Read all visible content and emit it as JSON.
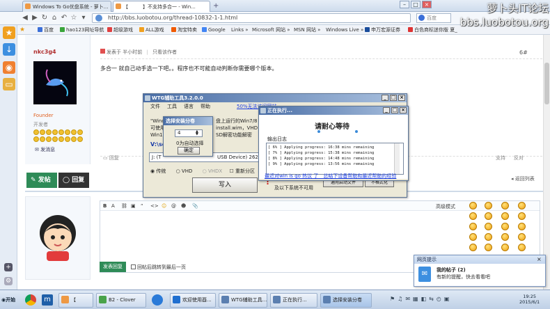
{
  "browser": {
    "tabs": [
      {
        "label": "Windows To Go优盘系统 - 萝卜...",
        "active": false
      },
      {
        "label": "【　　　】不支持多合一 - Win...",
        "active": true
      }
    ],
    "url": "http://bbs.luobotou.org/thread-10832-1-1.html",
    "search_placeholder": "百度",
    "bookmarks": [
      "百度",
      "hao123网址导航",
      "超级游戏",
      "ALL游戏",
      "淘宝特卖",
      "Google",
      "Links »",
      "Microsoft 网站 »",
      "MSN 网站 »",
      "Windows Live »",
      "申万宏源证券",
      "白色商标迷你版 夏_"
    ],
    "watermark": [
      "萝卜头IT论坛",
      "bbs.luobotou.org"
    ]
  },
  "post": {
    "username": "nkc3g4",
    "meta": "发表于 半小时前",
    "author_only": "只看该作者",
    "floor": "6#",
    "content": "多合一 就自己动手选一下吧。。程序也不可能自动判断你需要哪个版本。",
    "rank": "Founder",
    "rank2": "开发者",
    "send_msg": "发消息",
    "reply_link": "回复",
    "support": "支持",
    "oppose": "反对",
    "back_list": "返回列表",
    "btn_post": "发帖",
    "btn_reply": "回复",
    "editor_mode": "高级模式",
    "submit": "发表回复",
    "after_post": "回帖后跳转到最后一页"
  },
  "wtg": {
    "title": "WTG辅助工具3.2.0.0",
    "menu": [
      "文件",
      "工具",
      "语言",
      "帮助"
    ],
    "link": "50%无法访问网站",
    "text1": "\"Windows To Go\"...",
    "text2": "可使用",
    "text3": "Win10",
    "text4": "盘上运行的Win7/8",
    "text5": "install.wim，VHD",
    "text6": "SD解密功能解密",
    "drive_label": "V:\\so",
    "drive_value": "J: (T",
    "drive_tail": "USB Device) 262.",
    "options": [
      "传统",
      "VHD",
      "VHDX",
      "重新分区"
    ],
    "write_btn": "写入",
    "warn_text": "及以下系统不可用",
    "side_btn1": "通用启动文件",
    "side_btn2": "不格式化"
  },
  "select_dlg": {
    "title": "选择安装分卷",
    "value": "4",
    "hint": "0为自动选择",
    "ok": "确定"
  },
  "progress_dlg": {
    "title": "正在执行...",
    "heading": "请耐心等待",
    "log_label": "输出日志",
    "log_lines": [
      "[    6% ] Applying progress: 16:38 mins remaining",
      "[    7% ] Applying progress: 15:38 mins remaining",
      "[    8% ] Applying progress: 14:48 mins remaining",
      "[    9% ] Applying progress: 13:56 mins remaining"
    ],
    "footer": "最近对win is go 热议 了　总结下设备帮助和最近帮助的经验"
  },
  "notification": {
    "title": "网页提示",
    "heading": "我的帖子 (2)",
    "body": "有新的提醒，快去看看吧"
  },
  "taskbar": {
    "start": "开始",
    "items": [
      "【",
      "B2 - Clover",
      "欢迎使用酉...",
      "WTG辅助工具...",
      "正在执行...",
      "选择安装分卷"
    ],
    "time": "19:25",
    "date": "2015/6/1"
  }
}
